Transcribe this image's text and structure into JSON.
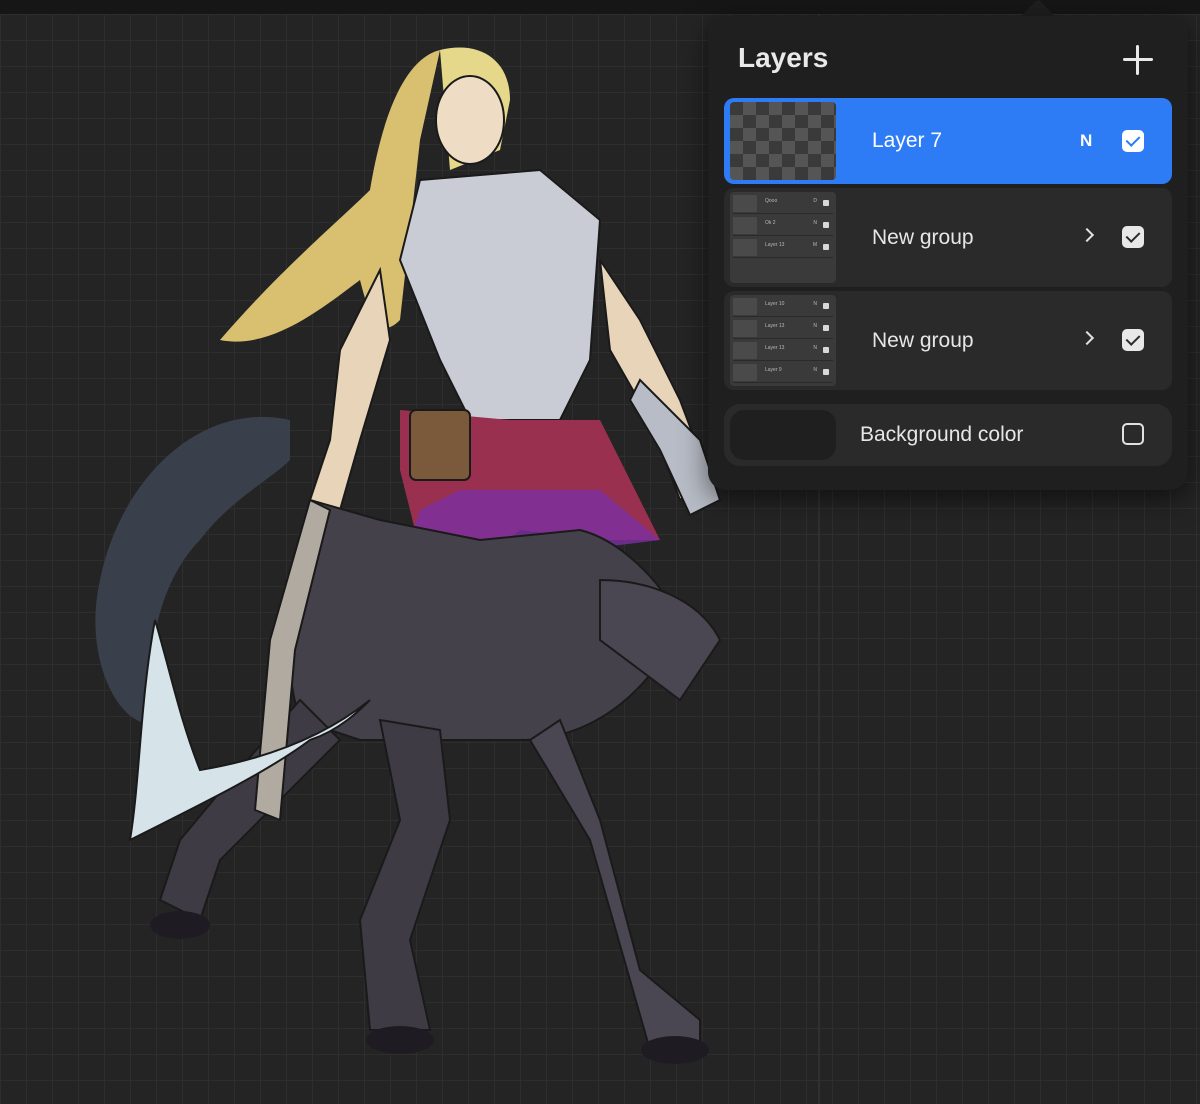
{
  "panel": {
    "title": "Layers",
    "add_icon": "plus-icon"
  },
  "layers": [
    {
      "name": "Layer 7",
      "blend_mode": "N",
      "visible": true,
      "selected": true,
      "type": "layer"
    },
    {
      "name": "New group",
      "visible": true,
      "selected": false,
      "type": "group",
      "children": [
        {
          "name": "Qooo",
          "mode": "D"
        },
        {
          "name": "Ok 2",
          "mode": "N"
        },
        {
          "name": "Layer 13",
          "mode": "M"
        }
      ]
    },
    {
      "name": "New group",
      "visible": true,
      "selected": false,
      "type": "group",
      "children": [
        {
          "name": "Layer 10",
          "mode": "N"
        },
        {
          "name": "Layer 13",
          "mode": "N"
        },
        {
          "name": "Layer 13",
          "mode": "N"
        },
        {
          "name": "Layer 9",
          "mode": "N"
        }
      ]
    }
  ],
  "background": {
    "label": "Background color",
    "visible": false
  },
  "colors": {
    "accent": "#2d7cf6",
    "panel": "#1f1f1f",
    "row": "#2a2a2a",
    "canvas": "#242424"
  }
}
